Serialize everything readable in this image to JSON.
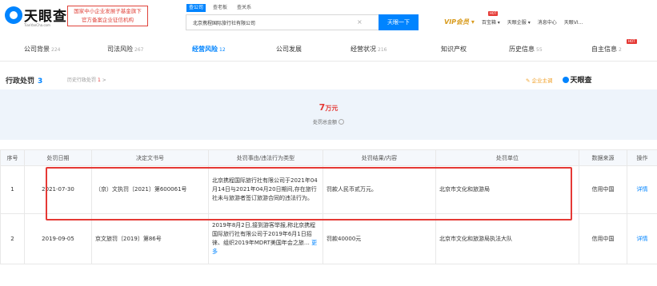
{
  "header": {
    "logo_title": "天眼查",
    "logo_subtitle": "TianYanCha.com",
    "gov_line1": "国家中小企业发展子基金旗下",
    "gov_line2": "官方备案企业征信机构",
    "search_tabs": [
      "查公司",
      "查老板",
      "查关系"
    ],
    "search_value": "北京携程国际旅行社有限公司",
    "search_button": "天眼一下",
    "nav": {
      "vip": "VIP会员",
      "hot_badge": "HOT",
      "treasure": "百宝箱",
      "enterprise": "天眼企服",
      "messages": "消息中心",
      "user": "天眼VI..."
    }
  },
  "tabs": [
    {
      "label": "公司背景",
      "count": "224"
    },
    {
      "label": "司法风险",
      "count": "267"
    },
    {
      "label": "经营风险",
      "count": "12"
    },
    {
      "label": "公司发展",
      "count": ""
    },
    {
      "label": "经营状况",
      "count": "216"
    },
    {
      "label": "知识产权",
      "count": ""
    },
    {
      "label": "历史信息",
      "count": "55"
    },
    {
      "label": "自主信息",
      "count": "2"
    }
  ],
  "section": {
    "title": "行政处罚",
    "count": "3",
    "history_label": "历史行政处罚",
    "history_count": "1",
    "history_arrow": ">",
    "follow": "企业主调",
    "watermark": "天眼查"
  },
  "summary": {
    "amount": "7",
    "unit": "万元",
    "label": "处罚总金额"
  },
  "table": {
    "headers": [
      "序号",
      "处罚日期",
      "决定文书号",
      "处罚事由/违法行为类型",
      "处罚结果/内容",
      "处罚单位",
      "数据来源",
      "操作"
    ],
    "rows": [
      {
        "index": "1",
        "date": "2021-07-30",
        "doc": "（京）文执罚〔2021〕第600061号",
        "reason": "北京携程国际旅行社有限公司于2021年04月14日与2021年04月20日期间,存在旅行社未与旅游者签订旅游合同的违法行为。",
        "result": "罚款人民币贰万元。",
        "unit": "北京市文化和旅游局",
        "source": "信用中国",
        "action": "详情"
      },
      {
        "index": "2",
        "date": "2019-09-05",
        "doc": "京文旅罚〔2019〕第86号",
        "reason": "2019年8月2日,接到游客举报,称北京携程国际旅行社有限公司于2019年6月1日招徕、组织2019年MDRT美国年会之旅…",
        "more": "更多",
        "result": "罚款40000元",
        "unit": "北京市文化和旅游局执法大队",
        "source": "信用中国",
        "action": "详情"
      }
    ]
  }
}
